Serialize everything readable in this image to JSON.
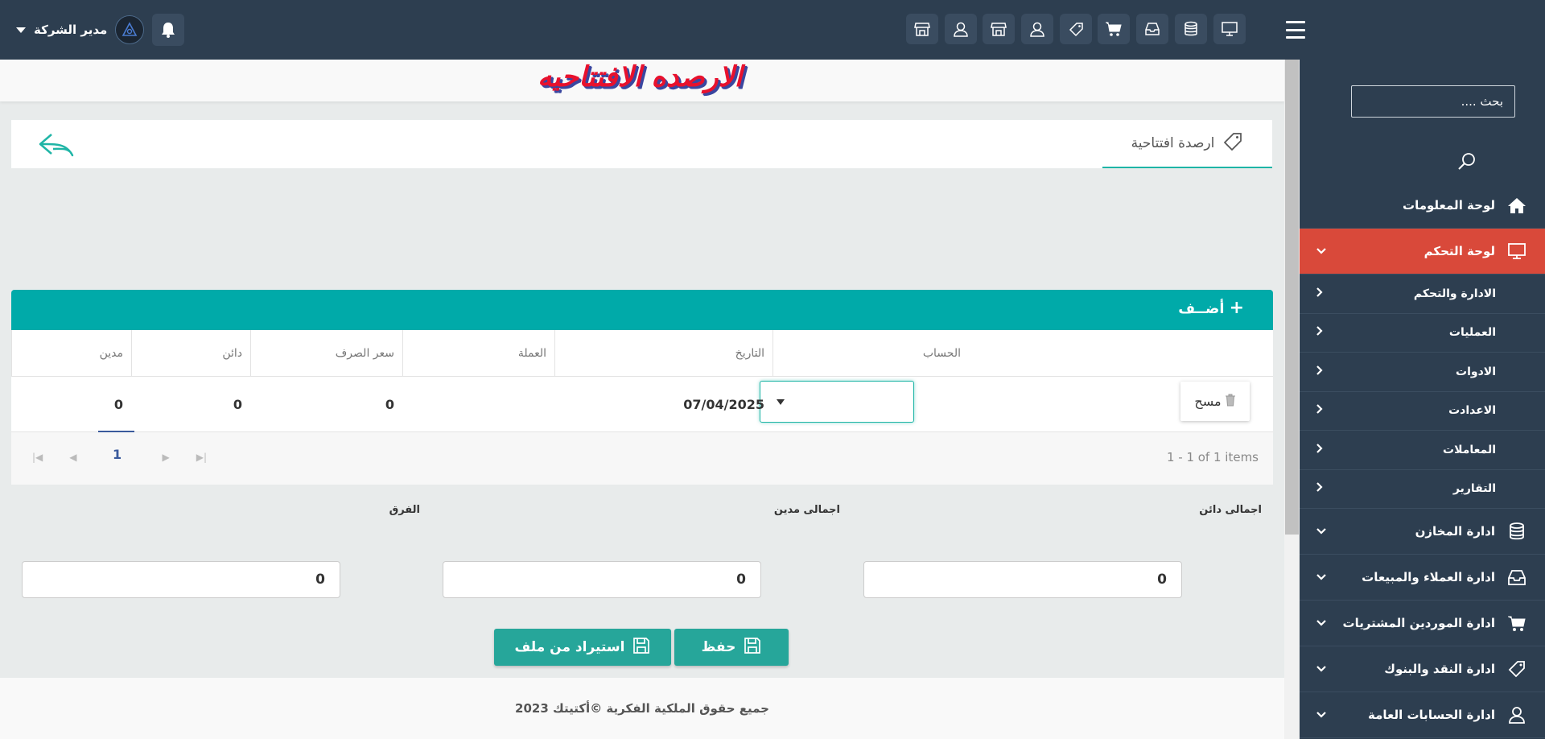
{
  "header": {
    "user_name": "مدير الشركة",
    "toolbar_icons": [
      "shop-icon",
      "user-icon",
      "shop-icon",
      "user-icon",
      "money-icon",
      "cart-icon",
      "inbox-icon",
      "database-icon",
      "monitor-icon"
    ]
  },
  "sidebar": {
    "search_placeholder": "بحث ....",
    "items": [
      {
        "label": "لوحة المعلومات",
        "icon": "home-icon"
      },
      {
        "label": "لوحة التحكم",
        "icon": "monitor-icon",
        "active": true
      },
      {
        "label": "الادارة والتحكم",
        "sub": true
      },
      {
        "label": "العمليات",
        "sub": true
      },
      {
        "label": "الادوات",
        "sub": true
      },
      {
        "label": "الاعدادت",
        "sub": true
      },
      {
        "label": "المعاملات",
        "sub": true
      },
      {
        "label": "التقارير",
        "sub": true
      },
      {
        "label": "ادارة المخازن",
        "icon": "database-icon"
      },
      {
        "label": "ادارة العملاء والمبيعات",
        "icon": "inbox-icon"
      },
      {
        "label": "ادارة الموردين المشتريات",
        "icon": "cart-icon"
      },
      {
        "label": "ادارة النقد والبنوك",
        "icon": "money-icon"
      },
      {
        "label": "ادارة الحسابات العامة",
        "icon": "user-icon"
      }
    ]
  },
  "page": {
    "title": "الارصده الافتتاحيه",
    "tab_label": "ارصدة افتتاحية"
  },
  "grid": {
    "add_label": "أضــف",
    "columns": [
      "الحساب",
      "التاريخ",
      "العملة",
      "سعر الصرف",
      "دائن",
      "مدين"
    ],
    "row": {
      "delete_label": "مسح",
      "account": "",
      "date": "07/04/2025",
      "currency": "",
      "rate": "0",
      "credit": "0",
      "debit": "0"
    },
    "page_number": "1",
    "page_info": "1 - 1 of 1 items"
  },
  "totals": {
    "credit_label": "اجمالى دائن",
    "credit_value": "0",
    "debit_label": "اجمالى مدين",
    "debit_value": "0",
    "diff_label": "الفرق",
    "diff_value": "0"
  },
  "actions": {
    "save_label": "حفظ",
    "import_label": "استيراد من ملف"
  },
  "footer": {
    "text": "جميع حقوق الملكية الفكرية ©أكتيتك 2023"
  }
}
